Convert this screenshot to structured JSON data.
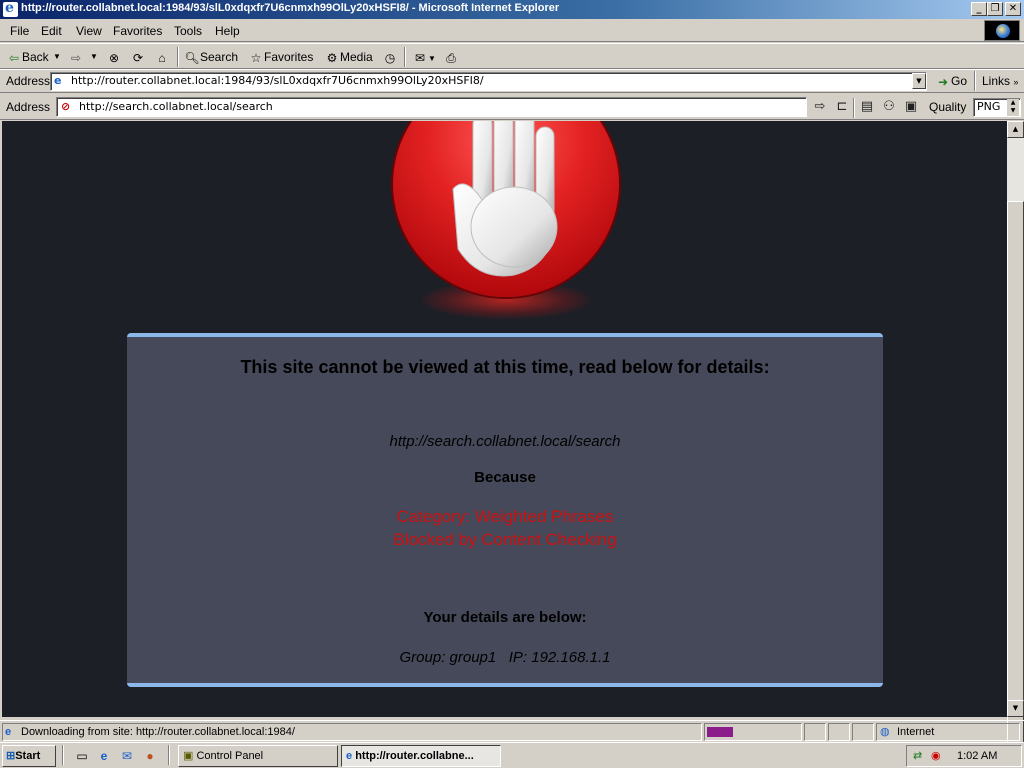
{
  "window": {
    "title": "http://router.collabnet.local:1984/93/slL0xdqxfr7U6cnmxh99OlLy20xHSFI8/ - Microsoft Internet Explorer"
  },
  "menu": [
    "File",
    "Edit",
    "View",
    "Favorites",
    "Tools",
    "Help"
  ],
  "toolbar": {
    "back": "Back",
    "search": "Search",
    "favorites": "Favorites",
    "media": "Media"
  },
  "address_bar": {
    "label": "Address",
    "url": "http://router.collabnet.local:1984/93/slL0xdqxfr7U6cnmxh99OlLy20xHSFI8/",
    "go": "Go",
    "links": "Links"
  },
  "secondary_bar": {
    "label": "Address",
    "url": "http://search.collabnet.local/search",
    "quality_label": "Quality",
    "quality_value": "PNG"
  },
  "page": {
    "heading": "This site cannot be viewed at this time, read below for details:",
    "blocked_url": "http://search.collabnet.local/search",
    "because": "Because",
    "reason_line1": "Category: Weighted Phrases",
    "reason_line2": "Blocked by Content Checking",
    "details_heading": "Your details are below:",
    "details": "Group: group1   IP: 192.168.1.1",
    "accent_color": "#8bb8e8",
    "reason_color": "#cc1010"
  },
  "status": {
    "text": "Downloading from site: http://router.collabnet.local:1984/",
    "progress": 0.28,
    "zone": "Internet"
  },
  "taskbar": {
    "start": "Start",
    "tasks": [
      "Control Panel",
      "http://router.collabne..."
    ],
    "clock": "1:02 AM"
  }
}
